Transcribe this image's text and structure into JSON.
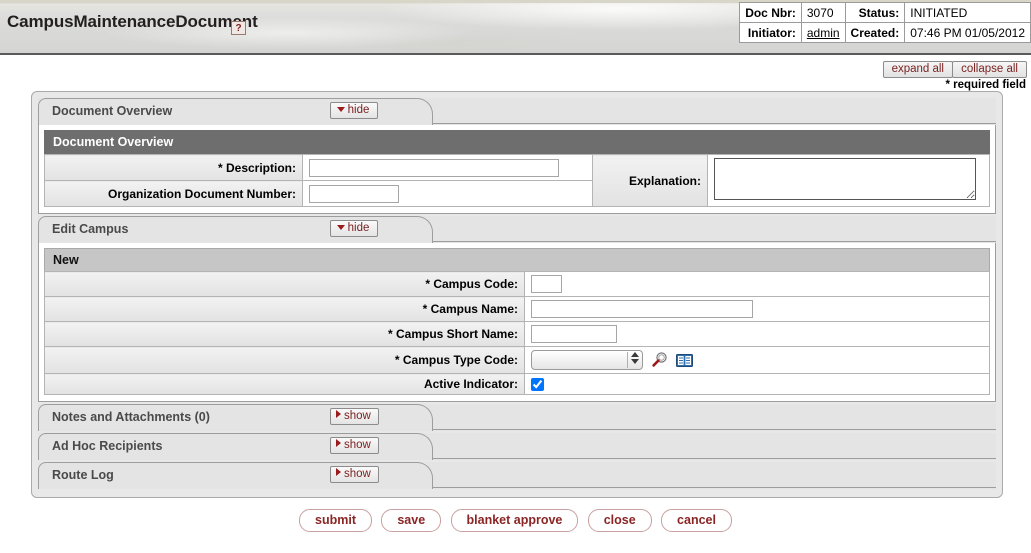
{
  "header": {
    "title": "CampusMaintenanceDocument",
    "help_icon": "question-mark-icon",
    "help_label": "?",
    "doc_info": [
      {
        "label": "Doc Nbr:",
        "value": "3070",
        "label2": "Status:",
        "value2": "INITIATED"
      },
      {
        "label": "Initiator:",
        "value": "admin",
        "label2": "Created:",
        "value2": "07:46 PM 01/05/2012"
      }
    ]
  },
  "toolbar": {
    "expand_all": "expand all",
    "collapse_all": "collapse all",
    "required_note": "* required field"
  },
  "sections": {
    "document_overview": {
      "tab_title": "Document Overview",
      "toggle_label": "hide",
      "subhead": "Document Overview",
      "fields": {
        "description_label": "* Description:",
        "description_value": "",
        "org_doc_number_label": "Organization Document Number:",
        "org_doc_number_value": "",
        "explanation_label": "Explanation:",
        "explanation_value": ""
      }
    },
    "edit_campus": {
      "tab_title": "Edit Campus",
      "toggle_label": "hide",
      "subhead": "New",
      "fields": {
        "campus_code_label": "* Campus Code:",
        "campus_code_value": "",
        "campus_name_label": "* Campus Name:",
        "campus_name_value": "",
        "campus_short_name_label": "* Campus Short Name:",
        "campus_short_name_value": "",
        "campus_type_code_label": "* Campus Type Code:",
        "campus_type_code_value": "",
        "campus_type_code_options": [
          ""
        ],
        "lookup_icon": "magnifier-icon",
        "direct_inquiry_icon": "open-book-icon",
        "active_indicator_label": "Active Indicator:",
        "active_indicator_checked": true
      }
    },
    "notes_and_attachments": {
      "tab_title": "Notes and Attachments (0)",
      "toggle_label": "show"
    },
    "ad_hoc_recipients": {
      "tab_title": "Ad Hoc Recipients",
      "toggle_label": "show"
    },
    "route_log": {
      "tab_title": "Route Log",
      "toggle_label": "show"
    }
  },
  "footer": {
    "buttons": [
      {
        "label": "submit"
      },
      {
        "label": "save"
      },
      {
        "label": "blanket approve"
      },
      {
        "label": "close"
      },
      {
        "label": "cancel"
      }
    ]
  },
  "colors": {
    "accent_red": "#7b2222",
    "triangle_red": "#9b1c1c",
    "subhead_dark": "#6e6e6e",
    "subhead_light": "#c6c6c6",
    "panel_bg": "#e8e8e8"
  }
}
